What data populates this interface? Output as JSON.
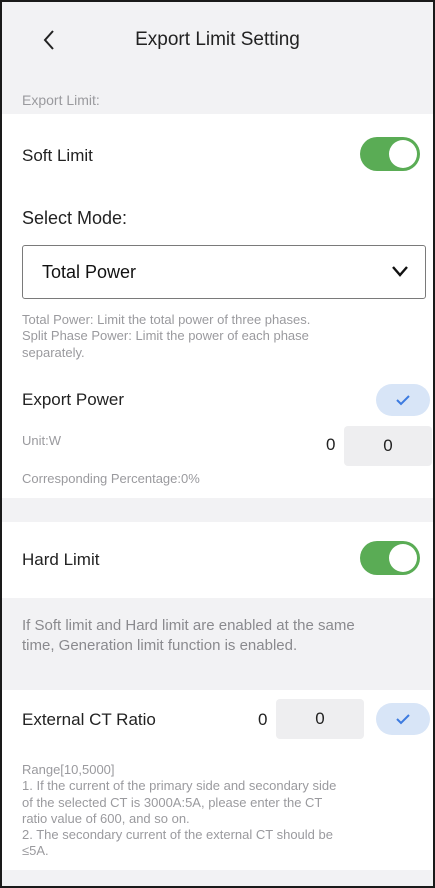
{
  "header": {
    "title": "Export Limit Setting"
  },
  "section_label": "Export Limit:",
  "soft_limit": {
    "label": "Soft Limit",
    "enabled": true
  },
  "select_mode": {
    "label": "Select Mode:",
    "value": "Total Power",
    "hint_lines": [
      "Total Power: Limit the total power of three phases.",
      "Split Phase Power: Limit the power of each phase",
      "separately."
    ]
  },
  "export_power": {
    "label": "Export Power",
    "unit": "Unit:W",
    "current_value": "0",
    "input_value": "0",
    "percentage": "Corresponding Percentage:0%"
  },
  "hard_limit": {
    "label": "Hard Limit",
    "enabled": true,
    "note_lines": [
      "If Soft limit and Hard limit are enabled at the same",
      "time, Generation limit function  is enabled."
    ]
  },
  "external_ct": {
    "label": "External CT Ratio",
    "current_value": "0",
    "input_value": "0",
    "notes": [
      "Range[10,5000]",
      "1. If the current of the primary side and secondary side",
      "of the selected CT is 3000A:5A, please enter the CT",
      "ratio value of 600, and so on.",
      "2. The secondary current of the external CT should be",
      "≤5A."
    ]
  },
  "colors": {
    "toggle_on": "#5aac55",
    "confirm_bg": "#d8e5f7",
    "confirm_check": "#3d7be0"
  },
  "icons": {
    "back": "chevron-left-icon",
    "dropdown": "chevron-down-icon",
    "confirm": "check-icon"
  }
}
